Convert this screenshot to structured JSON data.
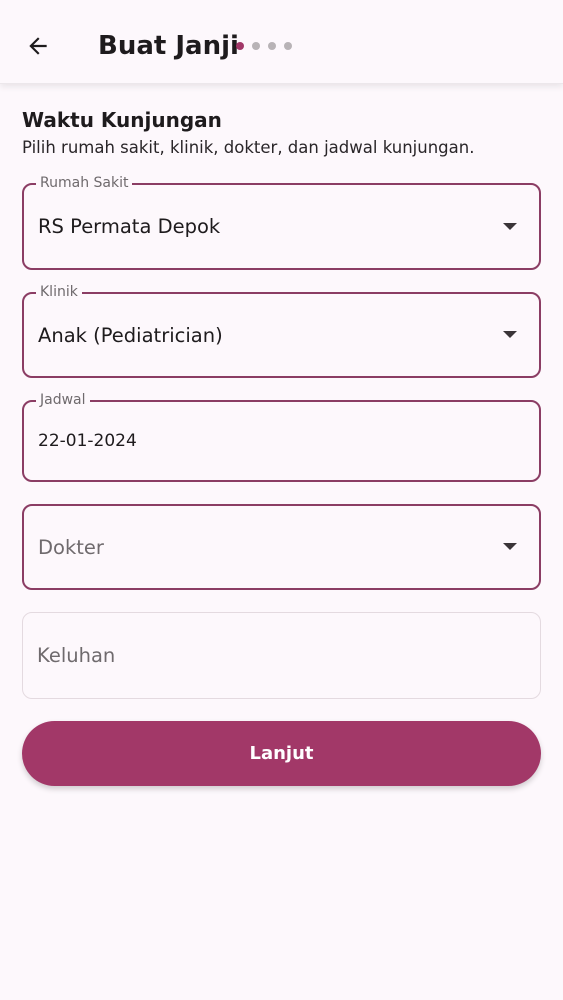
{
  "header": {
    "title": "Buat Janji",
    "steps": {
      "total": 4,
      "current": 1,
      "active_color": "#a23868",
      "inactive_color": "#b8b3b6"
    }
  },
  "section": {
    "title": "Waktu Kunjungan",
    "subtitle": "Pilih rumah sakit, klinik, dokter, dan jadwal kunjungan."
  },
  "form": {
    "hospital": {
      "label": "Rumah Sakit",
      "value": "RS Permata Depok"
    },
    "clinic": {
      "label": "Klinik",
      "value": "Anak (Pediatrician)"
    },
    "schedule": {
      "label": "Jadwal",
      "value": "22-01-2024"
    },
    "doctor": {
      "placeholder": "Dokter"
    },
    "complaint": {
      "placeholder": "Keluhan"
    }
  },
  "actions": {
    "next_label": "Lanjut"
  },
  "colors": {
    "accent": "#a23868",
    "field_border": "#8b3d64",
    "background": "#fdf8fc"
  },
  "icons": {
    "back": "arrow-left-icon",
    "dropdown": "chevron-down-icon"
  }
}
